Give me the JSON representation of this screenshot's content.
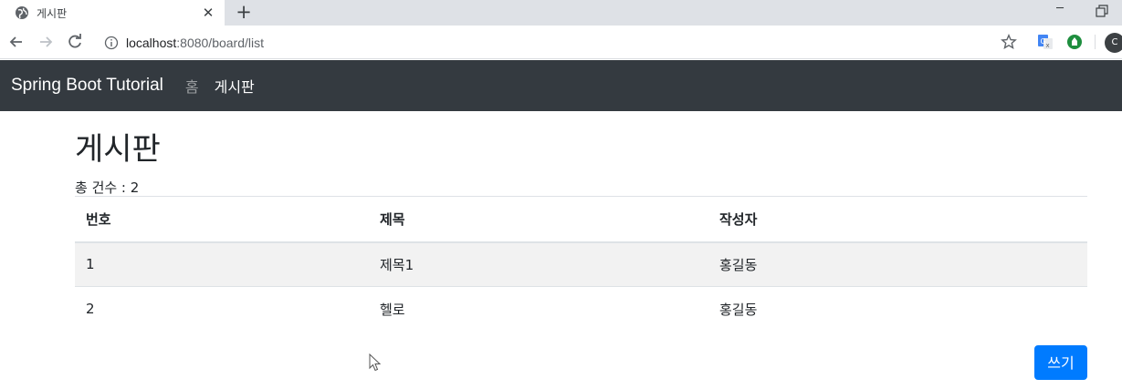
{
  "browser": {
    "tab_title": "게시판",
    "url_host": "localhost",
    "url_path": ":8080/board/list",
    "profile_initial": "C"
  },
  "navbar": {
    "brand": "Spring Boot Tutorial",
    "links": [
      {
        "label": "홈",
        "active": false
      },
      {
        "label": "게시판",
        "active": true
      }
    ]
  },
  "main": {
    "title": "게시판",
    "count_text": "총 건수 : 2",
    "table": {
      "headers": [
        "번호",
        "제목",
        "작성자"
      ],
      "rows": [
        [
          "1",
          "제목1",
          "홍길동"
        ],
        [
          "2",
          "헬로",
          "홍길동"
        ]
      ]
    },
    "write_button": "쓰기"
  },
  "colors": {
    "navbar_bg": "#343a40",
    "primary": "#007bff"
  }
}
